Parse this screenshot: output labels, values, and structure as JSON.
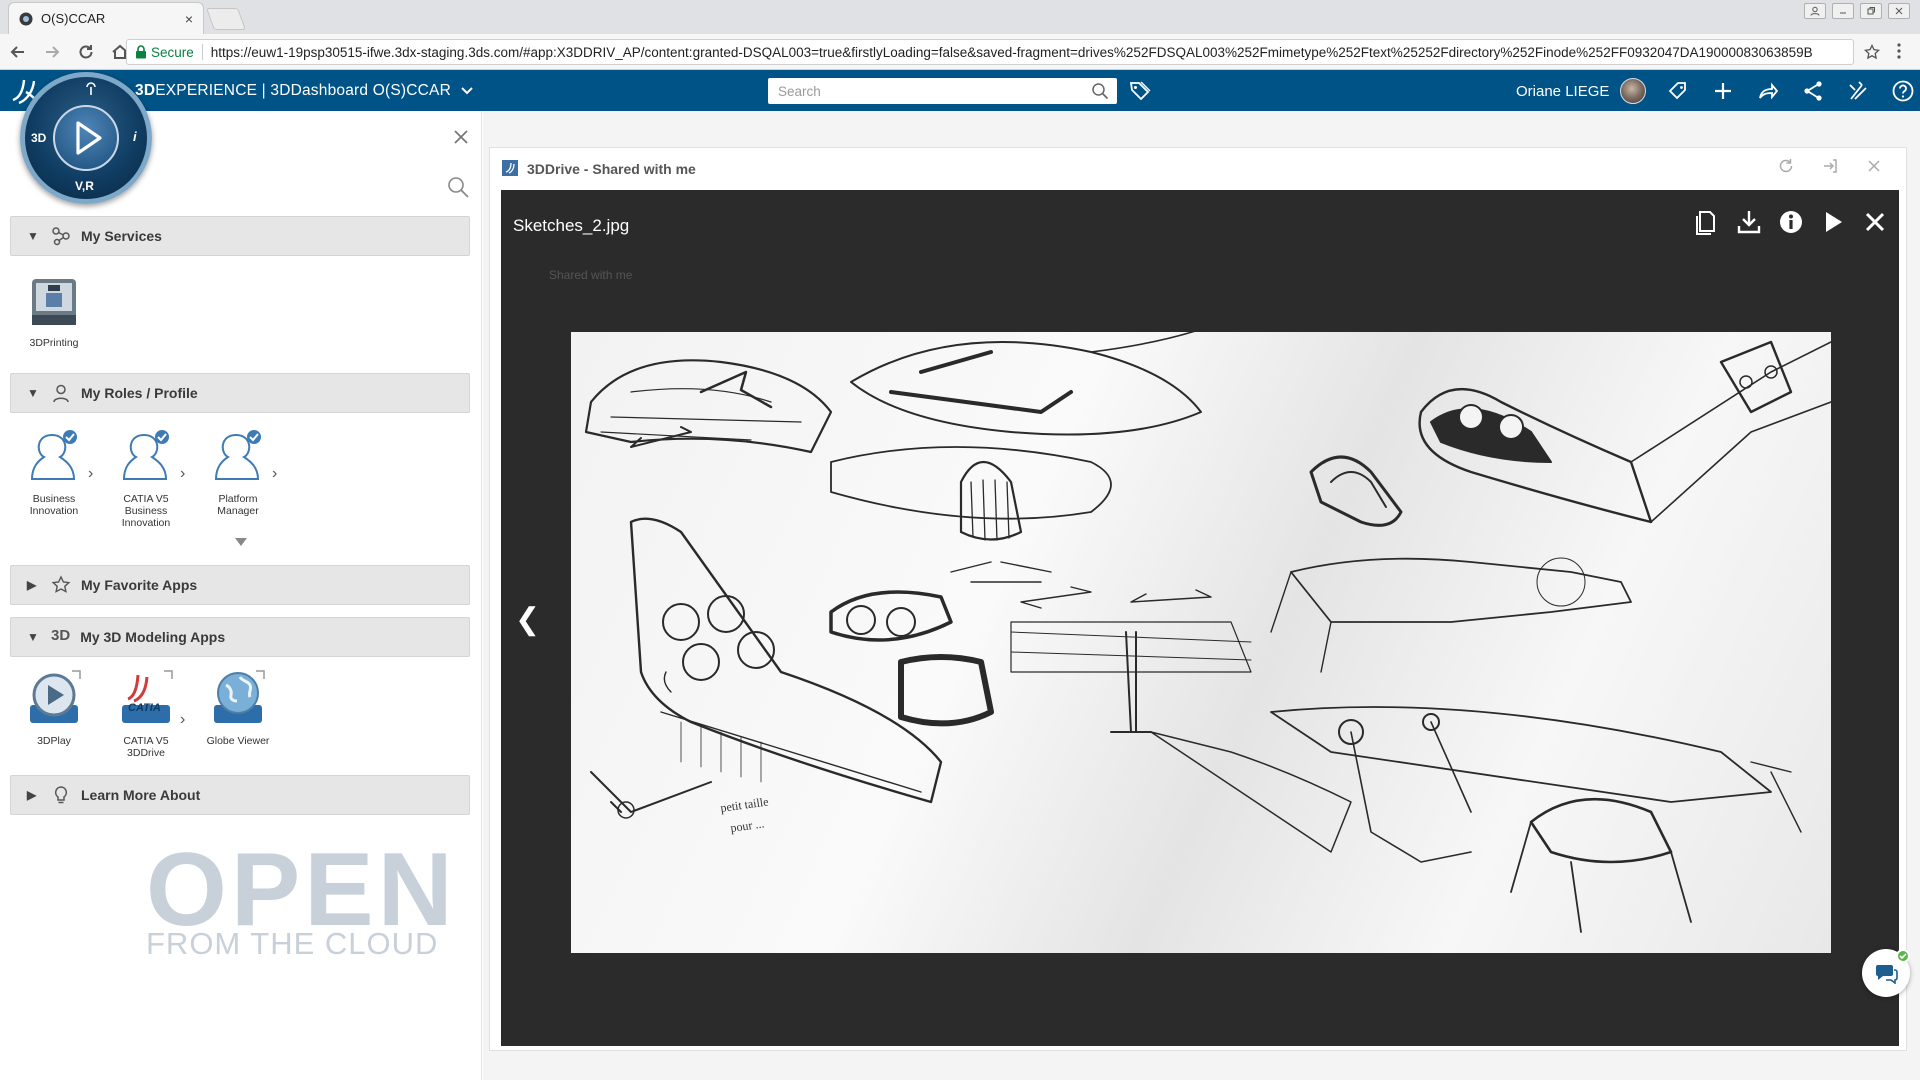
{
  "browser": {
    "tab_title": "O(S)CCAR",
    "tab_close": "×",
    "secure_label": "Secure",
    "url": "https://euw1-19psp30515-ifwe.3dx-staging.3ds.com/#app:X3DDRIV_AP/content:granted-DSQAL003=true&firstlyLoading=false&saved-fragment=drives%252FDSQAL003%252Fmimetype%252Ftext%25252Fdirectory%252Finode%252FF0932047DA1900008306385​9B"
  },
  "topbar": {
    "brand_bold": "3D",
    "brand_rest": "EXPERIENCE | 3DDashboard O(S)CCAR",
    "search_placeholder": "Search",
    "user_name": "Oriane LIEGE"
  },
  "compass": {
    "left_label": "3D",
    "bottom_label": "V,R",
    "right_label": "i"
  },
  "left_panel": {
    "sections": {
      "services": "My Services",
      "roles": "My Roles / Profile",
      "favorites": "My Favorite Apps",
      "modeling": "My 3D Modeling Apps",
      "learn": "Learn More About"
    },
    "services_tiles": [
      {
        "label": "3DPrinting"
      }
    ],
    "roles_tiles": [
      {
        "line1": "Business",
        "line2": "Innovation",
        "line3": ""
      },
      {
        "line1": "CATIA V5",
        "line2": "Business",
        "line3": "Innovation"
      },
      {
        "line1": "Platform",
        "line2": "Manager",
        "line3": ""
      }
    ],
    "modeling_tiles": [
      {
        "line1": "3DPlay",
        "line2": ""
      },
      {
        "line1": "CATIA V5",
        "line2": "3DDrive"
      },
      {
        "line1": "Globe Viewer",
        "line2": ""
      }
    ],
    "section_3d_icon": "3D",
    "brand_open": "OPEN",
    "brand_cloud": "FROM THE CLOUD"
  },
  "widget": {
    "title": "3DDrive - Shared with me",
    "file_name": "Sketches_2.jpg",
    "prev_arrow": "❮",
    "ghost_breadcrumb": "Shared with me"
  },
  "colors": {
    "topbar": "#005386",
    "accent": "#3b8ed0",
    "viewer_bg": "#2b2b2b"
  },
  "icons": [
    "lock-icon",
    "search-icon",
    "tag-icon",
    "share-icon",
    "plus-icon",
    "forward-icon",
    "network-icon",
    "tools-icon",
    "help-icon",
    "close-icon",
    "download-icon",
    "info-icon",
    "play-icon",
    "pages-icon",
    "chat-icon"
  ]
}
